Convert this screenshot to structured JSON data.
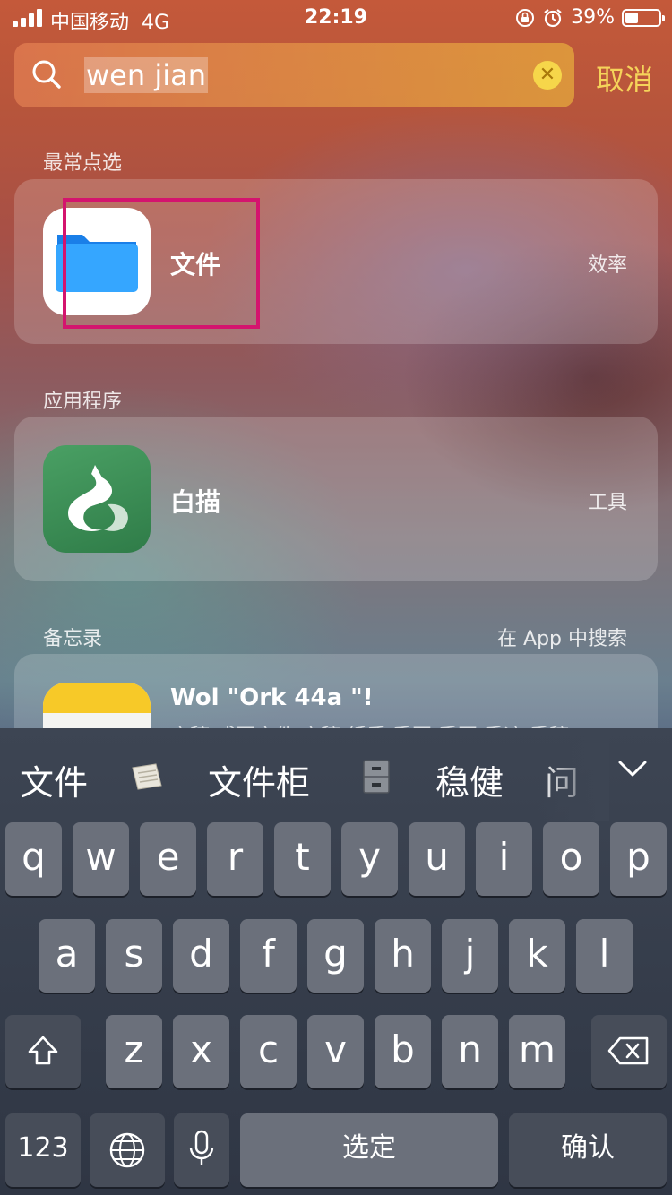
{
  "status_bar": {
    "carrier": "中国移动",
    "network": "4G",
    "time": "22:19",
    "battery": "39%",
    "battery_level": 0.39
  },
  "search": {
    "query": "wen jian",
    "cancel_label": "取消"
  },
  "sections": {
    "top_hits": {
      "title": "最常点选",
      "result": {
        "name": "文件",
        "category": "效率"
      }
    },
    "apps": {
      "title": "应用程序",
      "result": {
        "name": "白描",
        "category": "工具"
      }
    },
    "notes": {
      "title": "备忘录",
      "link": "在 App 中搜索",
      "result": {
        "title": "Wol \"Ork 44a \"!",
        "snippet": "文稿 或页文件 文稿 纸质 手写 手写 手迹 手稿"
      }
    }
  },
  "keyboard": {
    "candidates": [
      "文件",
      "文件柜",
      "稳健",
      "问"
    ],
    "row1": [
      "q",
      "w",
      "e",
      "r",
      "t",
      "y",
      "u",
      "i",
      "o",
      "p"
    ],
    "row2": [
      "a",
      "s",
      "d",
      "f",
      "g",
      "h",
      "j",
      "k",
      "l"
    ],
    "row3": [
      "z",
      "x",
      "c",
      "v",
      "b",
      "n",
      "m"
    ],
    "numbers_key": "123",
    "space_key": "选定",
    "confirm_key": "确认"
  },
  "colors": {
    "accent_yellow": "#f5d35a",
    "highlight_box": "#d4146e",
    "files_blue": "#1e8cf0",
    "baimiao_green": "#3f8f55"
  }
}
